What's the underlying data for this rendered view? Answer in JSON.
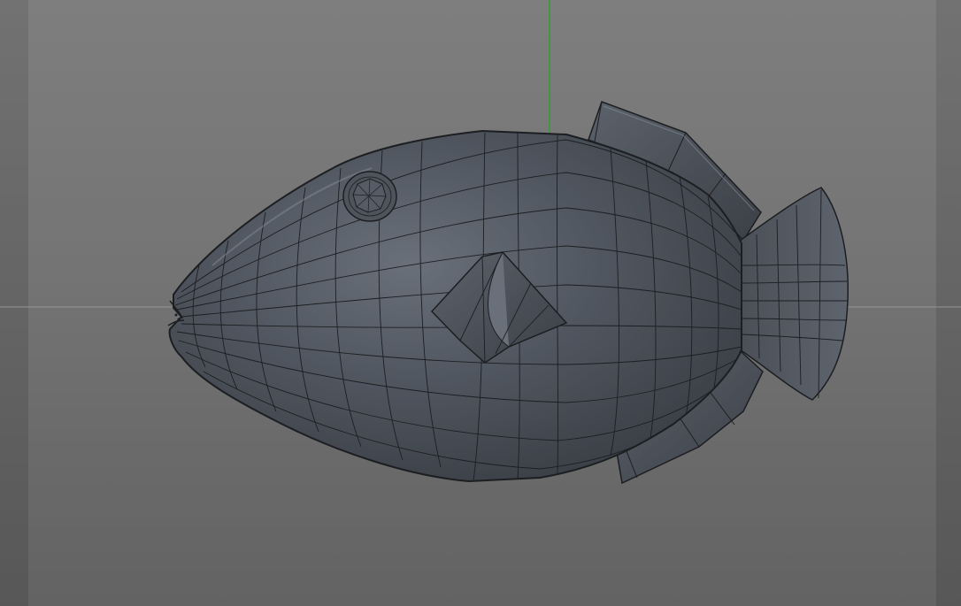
{
  "viewport": {
    "mode": "perspective",
    "background_top": "#7e7e7e",
    "background_bottom": "#636363",
    "x_axis_color": "#a8a8a8",
    "y_axis_color": "#2fa02f"
  },
  "model": {
    "object": "fish-mesh",
    "shading": "gouraud-with-wireframe",
    "surface_color": "#4b5058",
    "wire_color": "#1c1e22",
    "parts": [
      "body",
      "eye",
      "pectoral-fin",
      "dorsal-fin",
      "anal-fin",
      "tail-fin",
      "mouth"
    ]
  }
}
